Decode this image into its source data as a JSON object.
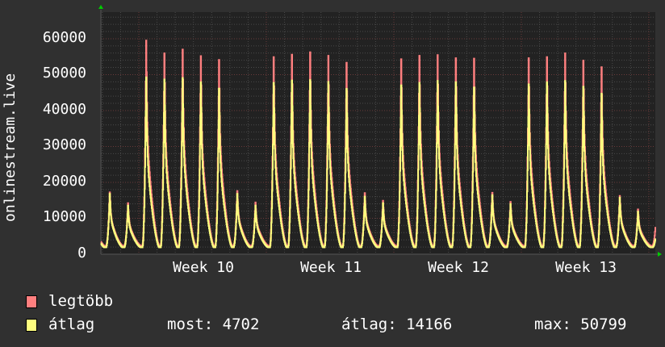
{
  "chart_data": {
    "type": "line",
    "ylabel": "onlinestream.live",
    "ylim": [
      0,
      67400
    ],
    "yticks": [
      0,
      10000,
      20000,
      30000,
      40000,
      50000,
      60000
    ],
    "ytick_labels": [
      "0",
      "10000",
      "20000",
      "30000",
      "40000",
      "50000",
      "60000"
    ],
    "xtick_labels": [
      "Week 10",
      "Week 11",
      "Week 12",
      "Week 13"
    ],
    "grid": true,
    "x_unit": "days (daily peaks, from 2 days before Week 10 through Week 13)",
    "x_days": [
      -2,
      -1,
      0,
      1,
      2,
      3,
      4,
      5,
      6,
      7,
      8,
      9,
      10,
      11,
      12,
      13,
      14,
      15,
      16,
      17,
      18,
      19,
      20,
      21,
      22,
      23,
      24,
      25,
      26,
      27,
      28
    ],
    "daily_low": {
      "legtöbb": 2300,
      "átlag": 1900
    },
    "series": [
      {
        "name": "legtöbb",
        "color": "#ff7f7f",
        "daily_peaks": [
          17700,
          14600,
          61400,
          57700,
          58800,
          56900,
          55800,
          18100,
          14800,
          56600,
          57300,
          58000,
          57000,
          55000,
          17500,
          15300,
          56000,
          57000,
          57200,
          56300,
          56200,
          17600,
          15000,
          56300,
          56600,
          57700,
          55600,
          53700,
          16700,
          12800,
          11000
        ]
      },
      {
        "name": "átlag",
        "color": "#ffff7f",
        "daily_peaks": [
          17300,
          13900,
          50800,
          50200,
          50600,
          49400,
          47600,
          17300,
          13900,
          49200,
          49900,
          50000,
          49500,
          47500,
          16500,
          14600,
          48500,
          49200,
          49800,
          49400,
          47900,
          16900,
          14400,
          48800,
          49400,
          49800,
          48100,
          46100,
          16200,
          12200,
          6000
        ]
      }
    ]
  },
  "legend": {
    "items": [
      {
        "label": "legtöbb",
        "color": "#ff7f7f"
      },
      {
        "label": "átlag",
        "color": "#ffff7f"
      }
    ],
    "stats": {
      "current": "most: 4702",
      "average": "átlag: 14166",
      "max": "max: 50799"
    }
  }
}
